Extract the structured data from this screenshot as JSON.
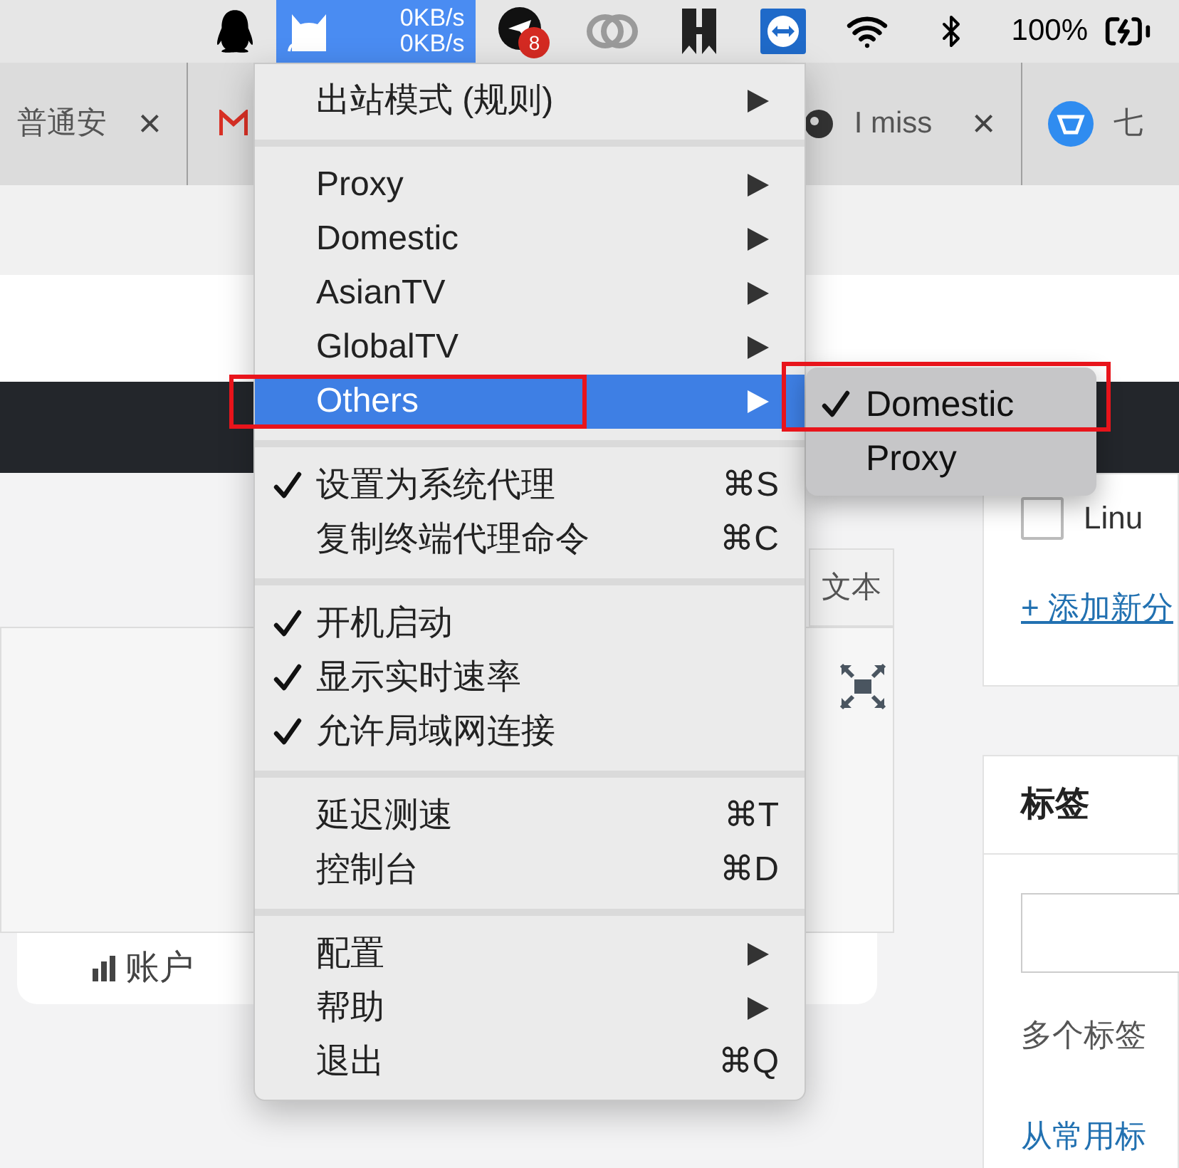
{
  "menubar": {
    "app": {
      "selected": true,
      "speed_up": "0KB/s",
      "speed_down": "0KB/s"
    },
    "badge": "8",
    "battery": "100%"
  },
  "tabs": [
    {
      "title": "普通安",
      "close": "×"
    },
    {
      "title": "I miss",
      "close": "×"
    },
    {
      "title": "七"
    }
  ],
  "page": {
    "column_header": "文本",
    "card_text": "账户",
    "checkbox": {
      "label": "Linu",
      "checked": false
    },
    "add_link": "+ 添加新分",
    "tags_title": "标签",
    "tags_hint": "多个标签",
    "tags_link": "从常用标"
  },
  "menu": {
    "sections": [
      [
        {
          "label": "出站模式 (规则)",
          "checked": false,
          "submenu": true,
          "selected": false,
          "framed": false
        }
      ],
      [
        {
          "label": "Proxy",
          "checked": false,
          "submenu": true,
          "selected": false,
          "framed": false
        },
        {
          "label": "Domestic",
          "checked": false,
          "submenu": true,
          "selected": false,
          "framed": false
        },
        {
          "label": "AsianTV",
          "checked": false,
          "submenu": true,
          "selected": false,
          "framed": false
        },
        {
          "label": "GlobalTV",
          "checked": false,
          "submenu": true,
          "selected": false,
          "framed": false
        },
        {
          "label": "Others",
          "checked": false,
          "submenu": true,
          "selected": true,
          "framed": true
        }
      ],
      [
        {
          "label": "设置为系统代理",
          "checked": true,
          "shortcut": "⌘S",
          "submenu": false,
          "selected": false,
          "framed": false
        },
        {
          "label": "复制终端代理命令",
          "checked": false,
          "shortcut": "⌘C",
          "submenu": false,
          "selected": false,
          "framed": false
        }
      ],
      [
        {
          "label": "开机启动",
          "checked": true,
          "submenu": false,
          "selected": false,
          "framed": false
        },
        {
          "label": "显示实时速率",
          "checked": true,
          "submenu": false,
          "selected": false,
          "framed": false
        },
        {
          "label": "允许局域网连接",
          "checked": true,
          "submenu": false,
          "selected": false,
          "framed": false
        }
      ],
      [
        {
          "label": "延迟测速",
          "checked": false,
          "shortcut": "⌘T",
          "submenu": false,
          "selected": false,
          "framed": false
        },
        {
          "label": "控制台",
          "checked": false,
          "shortcut": "⌘D",
          "submenu": false,
          "selected": false,
          "framed": false
        }
      ],
      [
        {
          "label": "配置",
          "checked": false,
          "submenu": true,
          "selected": false,
          "framed": false
        },
        {
          "label": "帮助",
          "checked": false,
          "submenu": true,
          "selected": false,
          "framed": false
        },
        {
          "label": "退出",
          "checked": false,
          "shortcut": "⌘Q",
          "submenu": false,
          "selected": false,
          "framed": false
        }
      ]
    ]
  },
  "submenu": {
    "items": [
      {
        "label": "Domestic",
        "checked": true,
        "framed": true
      },
      {
        "label": "Proxy",
        "checked": false,
        "framed": false
      }
    ]
  }
}
